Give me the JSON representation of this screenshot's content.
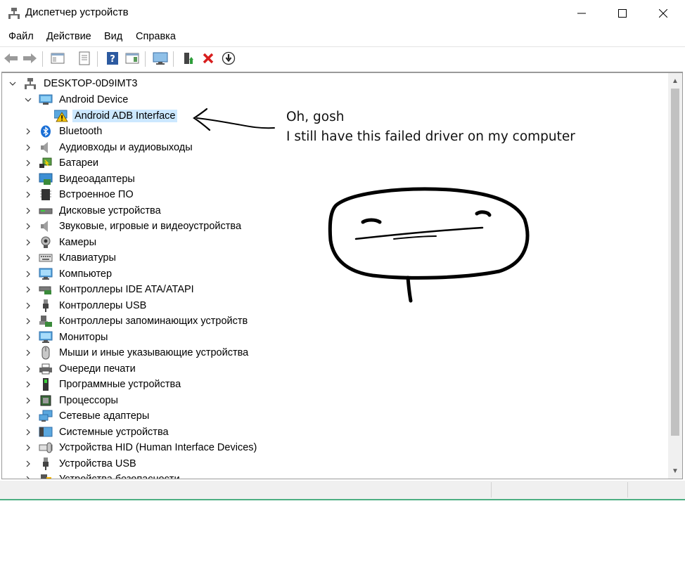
{
  "window": {
    "title": "Диспетчер устройств"
  },
  "menu": [
    "Файл",
    "Действие",
    "Вид",
    "Справка"
  ],
  "tree": {
    "root": "DESKTOP-0D9IMT3",
    "android_group": "Android Device",
    "android_child": "Android ADB Interface",
    "categories": [
      "Bluetooth",
      "Аудиовходы и аудиовыходы",
      "Батареи",
      "Видеоадаптеры",
      "Встроенное ПО",
      "Дисковые устройства",
      "Звуковые, игровые и видеоустройства",
      "Камеры",
      "Клавиатуры",
      "Компьютер",
      "Контроллеры IDE ATA/ATAPI",
      "Контроллеры USB",
      "Контроллеры запоминающих устройств",
      "Мониторы",
      "Мыши и иные указывающие устройства",
      "Очереди печати",
      "Программные устройства",
      "Процессоры",
      "Сетевые адаптеры",
      "Системные устройства",
      "Устройства HID (Human Interface Devices)",
      "Устройства USB",
      "Устройства безопасности"
    ]
  },
  "annotation": {
    "line1": "Oh, gosh",
    "line2": "I still have this failed driver on my computer"
  },
  "colors": {
    "selection": "#cce8ff",
    "warning": "#f5c400",
    "statusbar_border": "#4caf82"
  }
}
